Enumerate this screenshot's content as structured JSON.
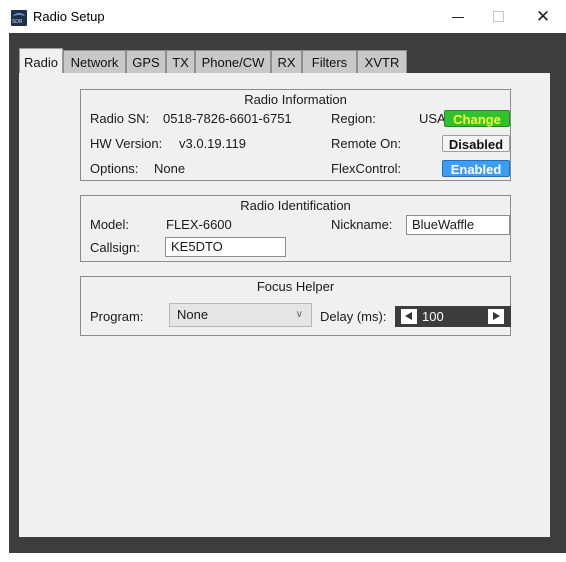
{
  "window": {
    "title": "Radio Setup",
    "icon": "sdr-app-icon",
    "icon_text": "SDR",
    "close_glyph": "✕"
  },
  "tabs": [
    {
      "label": "Radio",
      "active": true
    },
    {
      "label": "Network"
    },
    {
      "label": "GPS"
    },
    {
      "label": "TX"
    },
    {
      "label": "Phone/CW"
    },
    {
      "label": "RX"
    },
    {
      "label": "Filters"
    },
    {
      "label": "XVTR"
    }
  ],
  "radio_info": {
    "title": "Radio Information",
    "sn_label": "Radio SN:",
    "sn_value": "0518-7826-6601-6751",
    "region_label": "Region:",
    "region_value": "USA",
    "change_label": "Change",
    "hw_label": "HW Version:",
    "hw_value": "v3.0.19.119",
    "remote_label": "Remote On:",
    "remote_value": "Disabled",
    "options_label": "Options:",
    "options_value": "None",
    "flexcontrol_label": "FlexControl:",
    "flexcontrol_value": "Enabled"
  },
  "radio_id": {
    "title": "Radio Identification",
    "model_label": "Model:",
    "model_value": "FLEX-6600",
    "nickname_label": "Nickname:",
    "nickname_value": "BlueWaffle",
    "callsign_label": "Callsign:",
    "callsign_value": "KE5DTO"
  },
  "focus_helper": {
    "title": "Focus Helper",
    "program_label": "Program:",
    "program_value": "None",
    "delay_label": "Delay (ms):",
    "delay_value": "100"
  },
  "colors": {
    "change_bg": "#33bf2f",
    "change_text": "#f2ff3a",
    "enabled_bg": "#3d9df2",
    "frame": "#3d3d3d"
  }
}
